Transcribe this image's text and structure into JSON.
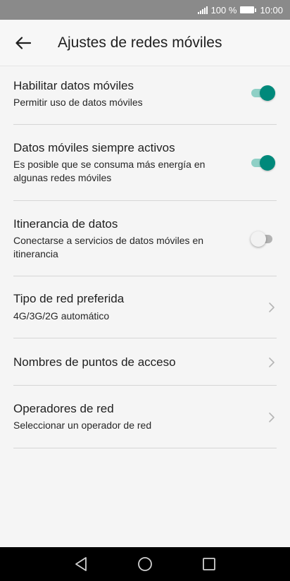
{
  "status_bar": {
    "battery_percent": "100 %",
    "time": "10:00",
    "icons": [
      "signal-icon",
      "battery-icon"
    ]
  },
  "header": {
    "back_icon": "arrow-left-icon",
    "title": "Ajustes de redes móviles"
  },
  "settings": [
    {
      "title": "Habilitar datos móviles",
      "subtitle": "Permitir uso de datos móviles",
      "control": "toggle",
      "enabled": true
    },
    {
      "title": "Datos móviles siempre activos",
      "subtitle": "Es posible que se consuma más energía en algunas redes móviles",
      "control": "toggle",
      "enabled": true
    },
    {
      "title": "Itinerancia de datos",
      "subtitle": "Conectarse a servicios de datos móviles en itinerancia",
      "control": "toggle",
      "enabled": false
    },
    {
      "title": "Tipo de red preferida",
      "subtitle": "4G/3G/2G automático",
      "control": "chevron"
    },
    {
      "title": "Nombres de puntos de acceso",
      "subtitle": "",
      "control": "chevron"
    },
    {
      "title": "Operadores de red",
      "subtitle": "Seleccionar un operador de red",
      "control": "chevron"
    }
  ],
  "colors": {
    "accent": "#00897b",
    "accent_track": "#8fd0c6",
    "status_bar": "#8a8a8a",
    "nav_bar": "#000000",
    "background": "#f5f5f5"
  },
  "nav_bar": {
    "icons": [
      "back-triangle-icon",
      "home-circle-icon",
      "recents-square-icon"
    ]
  }
}
